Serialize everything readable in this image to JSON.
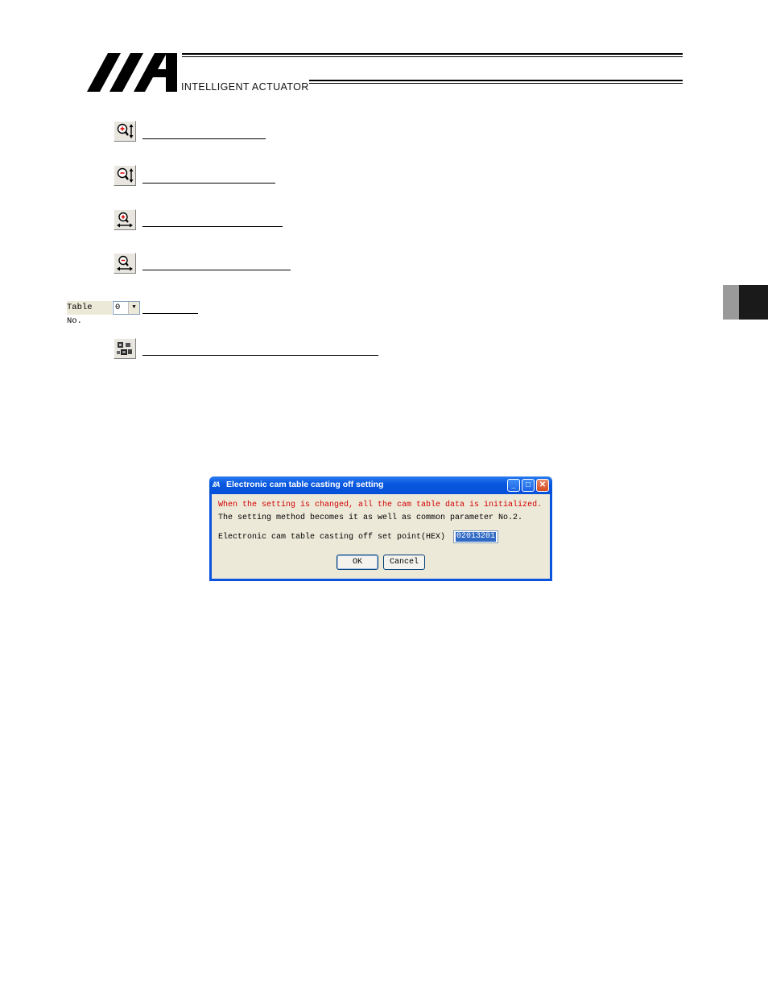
{
  "header": {
    "brand": "INTELLIGENT ACTUATOR"
  },
  "toolbar": {
    "items": [
      {
        "icon": "zoom-in-vertical-icon"
      },
      {
        "icon": "zoom-out-vertical-icon"
      },
      {
        "icon": "zoom-in-horizontal-icon"
      },
      {
        "icon": "zoom-out-horizontal-icon"
      },
      {
        "icon": "table-no-selector"
      },
      {
        "icon": "cam-table-setting-icon"
      }
    ],
    "table_no_label": "Table No.",
    "table_no_value": "0"
  },
  "dialog": {
    "title": "Electronic cam table casting off setting",
    "warning": "When the setting is changed, all the cam table data is initialized.",
    "note": "The setting method becomes it as well as common parameter No.2.",
    "field_label": "Electronic cam table casting off set point(HEX)",
    "field_value": "02013201",
    "ok_label": "OK",
    "cancel_label": "Cancel"
  },
  "colors": {
    "titlebar": "#0a58e0",
    "warning_text": "#d40000",
    "dialog_face": "#ece9d8",
    "selection": "#316ac5"
  }
}
